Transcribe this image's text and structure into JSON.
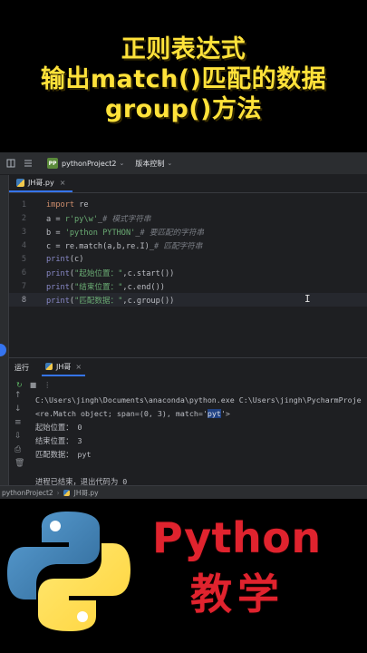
{
  "banner": {
    "line1": "正则表达式",
    "line2": "输出match()匹配的数据",
    "line3": "group()方法",
    "color": "#ffe23a"
  },
  "ide": {
    "topbar": {
      "menu_icon": "hamburger-icon",
      "project_badge": "PP",
      "project_name": "pythonProject2",
      "vcs_label": "版本控制"
    },
    "editor_tab": {
      "label": "JH哥.py",
      "icon": "python-file-icon"
    },
    "code_lines": [
      {
        "num": "1",
        "code": "import re"
      },
      {
        "num": "2",
        "code": "a = r'py\\w'_# 模式字符串"
      },
      {
        "num": "3",
        "code": "b = 'python PYTHON'_# 要匹配的字符串"
      },
      {
        "num": "4",
        "code": "c = re.match(a,b,re.I)_# 匹配字符串"
      },
      {
        "num": "5",
        "code": "print(c)"
      },
      {
        "num": "6",
        "code": "print(\"起始位置：\",c.start())"
      },
      {
        "num": "7",
        "code": "print(\"结束位置：\",c.end())"
      },
      {
        "num": "8",
        "code": "print(\"匹配数据：\",c.group())"
      }
    ],
    "run_panel": {
      "title": "运行",
      "tab_label": "JH哥",
      "console_lines": [
        "C:\\Users\\jingh\\Documents\\anaconda\\python.exe C:\\Users\\jingh\\PycharmProje",
        "<re.Match object; span=(0, 3), match='pyt'>",
        "起始位置： 0",
        "结束位置： 3",
        "匹配数据： pyt",
        "",
        "进程已结束，退出代码为 0"
      ]
    },
    "statusbar": {
      "project": "pythonProject2",
      "file": "JH哥.py"
    }
  },
  "bottom": {
    "title1": "Python",
    "title2": "教学",
    "color": "#e0232e",
    "logo": "python-logo"
  }
}
